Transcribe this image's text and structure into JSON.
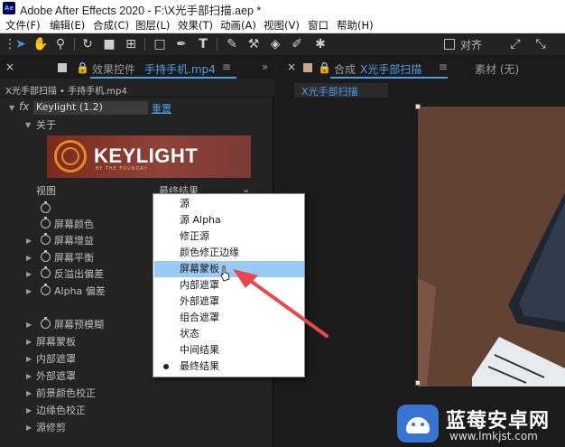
{
  "titlebar": {
    "logo": "Ae",
    "title": "Adobe After Effects 2020 - F:\\X光手部扫描.aep *"
  },
  "menubar": [
    "文件(F)",
    "编辑(E)",
    "合成(C)",
    "图层(L)",
    "效果(T)",
    "动画(A)",
    "视图(V)",
    "窗口",
    "帮助(H)"
  ],
  "toolbar": {
    "snap_label": "对齐"
  },
  "left_panel": {
    "tab_prefix": "效果控件",
    "tab_layer": "手持手机.mp4",
    "breadcrumb": "X光手部扫描 • 手持手机.mp4",
    "effect_name": "Keylight (1.2)",
    "reset": "重置",
    "about": "关于",
    "logo_name": "KEYLIGHT",
    "logo_sub": "BY THE FOUNDRY",
    "view_label": "视图",
    "view_value": "最终结果",
    "props": [
      "屏幕颜色",
      "屏幕增益",
      "屏幕平衡",
      "反溢出偏差",
      "Alpha 偏差",
      "屏幕预模糊",
      "屏幕蒙板",
      "内部遮罩",
      "外部遮罩",
      "前景颜色校正",
      "边缘色校正",
      "源修剪"
    ]
  },
  "dropdown": {
    "options": [
      "源",
      "源 Alpha",
      "修正源",
      "颜色修正边缘",
      "屏幕蒙板",
      "内部遮罩",
      "外部遮罩",
      "组合遮罩",
      "状态",
      "中间结果",
      "最终结果"
    ],
    "highlighted": "屏幕蒙板",
    "checked": "最终结果"
  },
  "right_panel": {
    "tab_prefix": "合成",
    "tab_comp": "X光手部扫描",
    "footage_tab": "素材 (无)",
    "comp_name": "X光手部扫描"
  },
  "watermark": {
    "name": "蓝莓安卓网",
    "url": "www.lmkjst.com"
  },
  "colors": {
    "accent_blue": "#4b9eea",
    "highlight": "#99c9f5",
    "arrow": "#e8474b"
  }
}
